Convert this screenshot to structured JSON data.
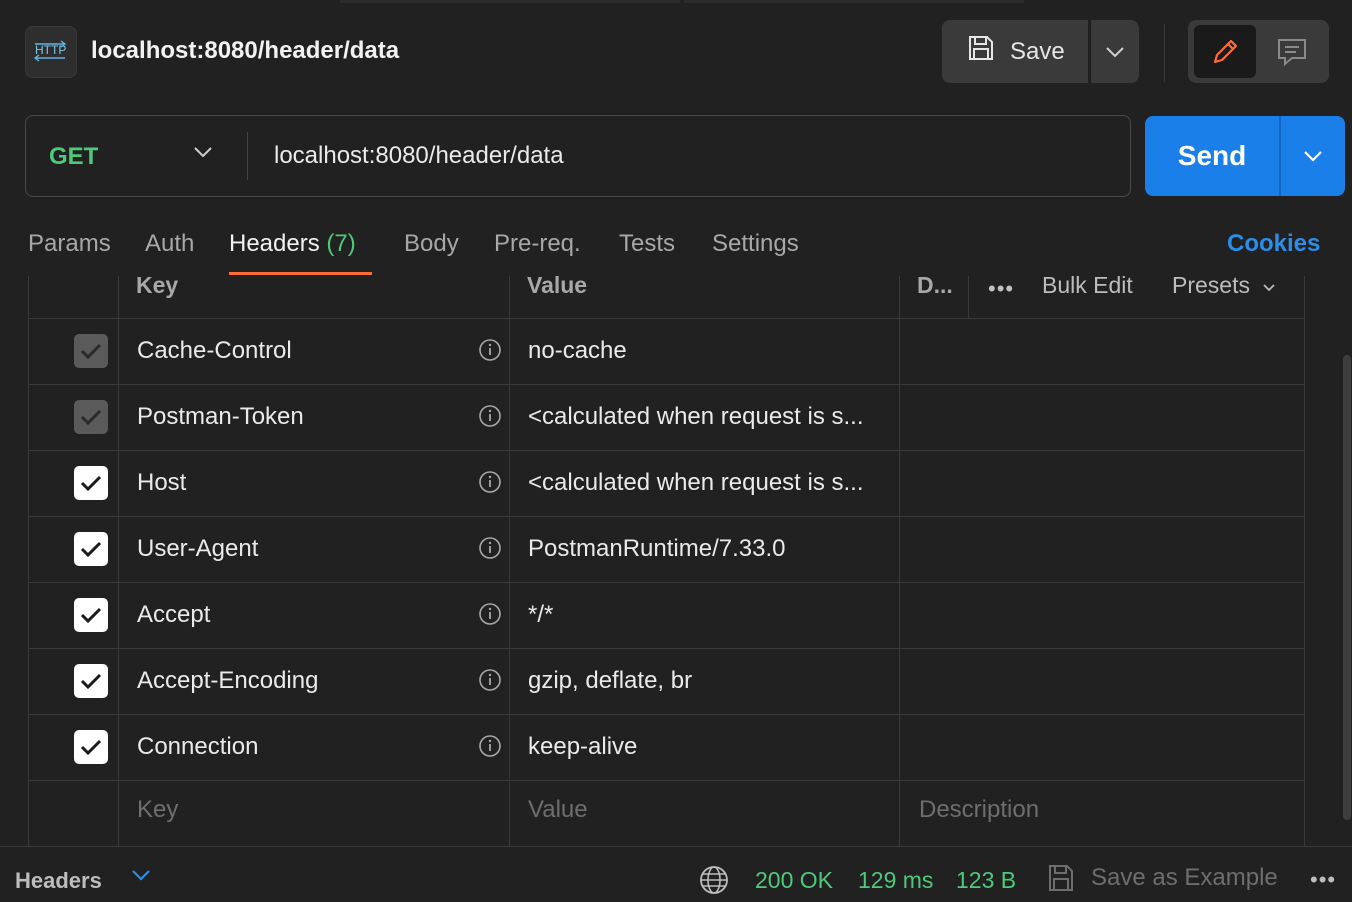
{
  "request": {
    "title": "localhost:8080/header/data",
    "icon": "http-icon",
    "method": "GET",
    "url": "localhost:8080/header/data"
  },
  "toolbar": {
    "save_label": "Save",
    "send_label": "Send"
  },
  "tabs": [
    {
      "label": "Params"
    },
    {
      "label": "Auth"
    },
    {
      "label": "Headers",
      "count": "(7)",
      "active": true
    },
    {
      "label": "Body"
    },
    {
      "label": "Pre-req."
    },
    {
      "label": "Tests"
    },
    {
      "label": "Settings"
    }
  ],
  "cookies_label": "Cookies",
  "table": {
    "columns": {
      "key": "Key",
      "value": "Value",
      "description": "D..."
    },
    "more": "•••",
    "bulk_edit": "Bulk Edit",
    "presets": "Presets",
    "rows": [
      {
        "checked": true,
        "auto": true,
        "key": "Cache-Control",
        "value": "no-cache"
      },
      {
        "checked": true,
        "auto": true,
        "key": "Postman-Token",
        "value": "<calculated when request is s..."
      },
      {
        "checked": true,
        "auto": false,
        "key": "Host",
        "value": "<calculated when request is s..."
      },
      {
        "checked": true,
        "auto": false,
        "key": "User-Agent",
        "value": "PostmanRuntime/7.33.0"
      },
      {
        "checked": true,
        "auto": false,
        "key": "Accept",
        "value": "*/*"
      },
      {
        "checked": true,
        "auto": false,
        "key": "Accept-Encoding",
        "value": "gzip, deflate, br"
      },
      {
        "checked": true,
        "auto": false,
        "key": "Connection",
        "value": "keep-alive"
      }
    ],
    "placeholder": {
      "key": "Key",
      "value": "Value",
      "description": "Description"
    }
  },
  "footer": {
    "section": "Headers",
    "status": "200 OK",
    "time": "129 ms",
    "size": "123 B",
    "save_example": "Save as Example",
    "more": "•••"
  },
  "colors": {
    "accent_orange": "#ff6c37",
    "send_blue": "#1a7fe8",
    "method_green": "#4ec97a",
    "cookies_blue": "#2b8de8"
  }
}
